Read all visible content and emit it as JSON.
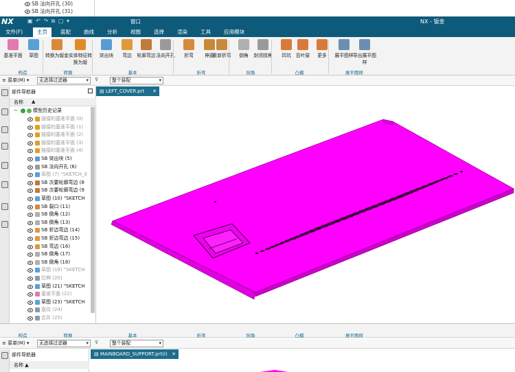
{
  "prev_tree": {
    "rows": [
      "SB 法向开孔 (30)",
      "SB 法向开孔 (31)"
    ]
  },
  "titlebar": {
    "logo": "NX",
    "window_menu": "窗口",
    "app_title": "NX - 钣金"
  },
  "menu": {
    "tabs": [
      "文件(F)",
      "主页",
      "装配",
      "曲线",
      "分析",
      "视图",
      "选择",
      "渲染",
      "工具",
      "应用模块"
    ],
    "active": "主页"
  },
  "ribbon": {
    "tools": [
      {
        "label": "基准平面",
        "icon": "datum-plane-icon",
        "color": "#e07ab0"
      },
      {
        "label": "草图",
        "icon": "sketch-icon",
        "color": "#5aa0d8"
      },
      {
        "label": "转换为钣金",
        "icon": "convert-icon",
        "color": "#d68a3a"
      },
      {
        "label": "实体特征转换为钣",
        "icon": "solid-convert-icon",
        "color": "#e08a2a"
      },
      {
        "label": "突出块",
        "icon": "tab-icon",
        "color": "#5b9bd5"
      },
      {
        "label": "弯边",
        "icon": "flange-icon",
        "color": "#e09a3a"
      },
      {
        "label": "轮廓弯边",
        "icon": "contour-flange-icon",
        "color": "#c07a3a"
      },
      {
        "label": "法向开孔",
        "icon": "normal-cutout-icon",
        "color": "#9a9a9a"
      },
      {
        "label": "折弯",
        "icon": "bend-icon",
        "color": "#d68a3a"
      },
      {
        "label": "伸直",
        "icon": "unbend-icon",
        "color": "#c88a3a"
      },
      {
        "label": "重新折弯",
        "icon": "rebend-icon",
        "color": "#c88a3a"
      },
      {
        "label": "倒角",
        "icon": "chamfer-icon",
        "color": "#b0b0b0"
      },
      {
        "label": "封闭拐角",
        "icon": "closed-corner-icon",
        "color": "#9a9a9a"
      },
      {
        "label": "凹坑",
        "icon": "dimple-icon",
        "color": "#d87a3a"
      },
      {
        "label": "百叶窗",
        "icon": "louver-icon",
        "color": "#d87a3a"
      },
      {
        "label": "更多",
        "icon": "more-icon",
        "color": "#d87a3a"
      },
      {
        "label": "展平图样",
        "icon": "flat-pattern-icon",
        "color": "#6a8fb0"
      },
      {
        "label": "导出展平图样",
        "icon": "export-flat-icon",
        "color": "#6a8fb0"
      }
    ],
    "groups": [
      "构造",
      "转换",
      "基本",
      "折弯",
      "拐角",
      "凸模",
      "展平图样"
    ]
  },
  "filterbar": {
    "menu_label": "菜单(M)",
    "type_filter": "无选择过滤器",
    "scope": "整个装配"
  },
  "part_navigator": {
    "title": "部件导航器",
    "column_header": "名称",
    "root": "模型历史记录",
    "rows": [
      {
        "label": "链接的基准平面 (0)",
        "dim": true,
        "color": "#e0a020"
      },
      {
        "label": "链接的基准平面 (1)",
        "dim": true,
        "color": "#e0a020"
      },
      {
        "label": "链接的基准平面 (2)",
        "dim": true,
        "color": "#e0a020"
      },
      {
        "label": "链接的基准平面 (3)",
        "dim": true,
        "color": "#e0a020"
      },
      {
        "label": "链接的基准平面 (4)",
        "dim": true,
        "color": "#e0a020"
      },
      {
        "label": "SB 突出块 (5)",
        "dim": false,
        "color": "#5b9bd5"
      },
      {
        "label": "SB 法向开孔 (6)",
        "dim": false,
        "color": "#9a9a9a"
      },
      {
        "label": "草图 (7) \"SKETCH_0",
        "dim": true,
        "color": "#5aa0d8"
      },
      {
        "label": "SB 次要轮廓弯边 (8",
        "dim": false,
        "color": "#c07a3a"
      },
      {
        "label": "SB 次要轮廓弯边 (9",
        "dim": false,
        "color": "#c07a3a"
      },
      {
        "label": "草图 (10) \"SKETCH",
        "dim": false,
        "color": "#5aa0d8"
      },
      {
        "label": "SB 裂口 (11)",
        "dim": false,
        "color": "#d68a3a"
      },
      {
        "label": "SB 倒角 (12)",
        "dim": false,
        "color": "#b0b0b0"
      },
      {
        "label": "SB 倒角 (13)",
        "dim": false,
        "color": "#b0b0b0"
      },
      {
        "label": "SB 折边弯边 (14)",
        "dim": false,
        "color": "#e09a3a"
      },
      {
        "label": "SB 折边弯边 (15)",
        "dim": false,
        "color": "#e09a3a"
      },
      {
        "label": "SB 弯边 (16)",
        "dim": false,
        "color": "#e09a3a"
      },
      {
        "label": "SB 倒角 (17)",
        "dim": false,
        "color": "#b0b0b0"
      },
      {
        "label": "SB 倒角 (18)",
        "dim": false,
        "color": "#b0b0b0"
      },
      {
        "label": "草图 (19) \"SKETCH",
        "dim": true,
        "color": "#5aa0d8"
      },
      {
        "label": "拉伸 (20)",
        "dim": true,
        "color": "#8a9aa8"
      },
      {
        "label": "草图 (21) \"SKETCH",
        "dim": false,
        "color": "#5aa0d8"
      },
      {
        "label": "基准平面 (22)",
        "dim": true,
        "color": "#e07ab0"
      },
      {
        "label": "草图 (23) \"SKETCH",
        "dim": false,
        "color": "#5aa0d8"
      },
      {
        "label": "直纹 (24)",
        "dim": true,
        "color": "#8a9aa8"
      },
      {
        "label": "合并 (25)",
        "dim": true,
        "color": "#8a9aa8"
      }
    ]
  },
  "graphics": {
    "tab_label": "LEFT_COVER.prt",
    "model_color": "#ff00ff"
  },
  "bottom": {
    "groups": [
      "构造",
      "转换",
      "基本",
      "折弯",
      "拐角",
      "凸模",
      "展平图样"
    ],
    "menu_label": "菜单(M)",
    "type_filter": "无选择过滤器",
    "scope": "整个装配",
    "nav_title": "部件导航器",
    "nav_header": "名称",
    "tab_label": "MAINBOARD_SUPPORT.prt(I)"
  }
}
